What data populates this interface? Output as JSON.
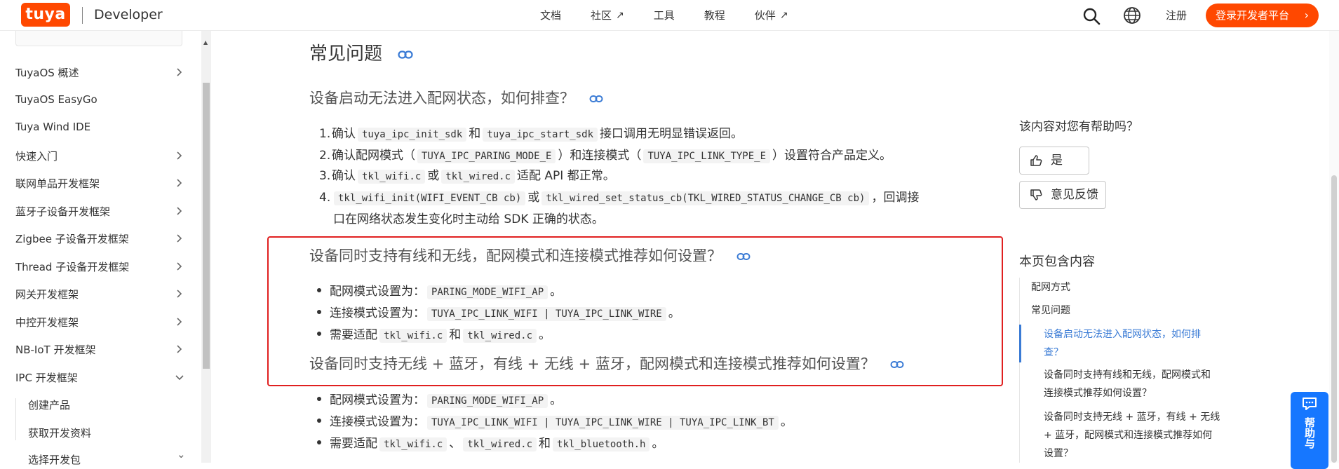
{
  "header": {
    "logo_text": "tuya",
    "developer_label": "Developer",
    "nav": [
      {
        "label": "文档",
        "external": false
      },
      {
        "label": "社区",
        "external": true
      },
      {
        "label": "工具",
        "external": false
      },
      {
        "label": "教程",
        "external": false
      },
      {
        "label": "伙伴",
        "external": true
      }
    ],
    "register_label": "注册",
    "login_label": "登录开发者平台"
  },
  "sidebar": {
    "items": [
      {
        "label": "TuyaOS 概述",
        "chevron": "right"
      },
      {
        "label": "TuyaOS EasyGo",
        "chevron": ""
      },
      {
        "label": "Tuya Wind IDE",
        "chevron": ""
      },
      {
        "label": "快速入门",
        "chevron": "right"
      },
      {
        "label": "联网单品开发框架",
        "chevron": "right"
      },
      {
        "label": "蓝牙子设备开发框架",
        "chevron": "right"
      },
      {
        "label": "Zigbee 子设备开发框架",
        "chevron": "right"
      },
      {
        "label": "Thread 子设备开发框架",
        "chevron": "right"
      },
      {
        "label": "网关开发框架",
        "chevron": "right"
      },
      {
        "label": "中控开发框架",
        "chevron": "right"
      },
      {
        "label": "NB-IoT 开发框架",
        "chevron": "right"
      },
      {
        "label": "IPC 开发框架",
        "chevron": "down"
      }
    ],
    "sub_items": [
      {
        "label": "创建产品"
      },
      {
        "label": "获取开发资料"
      },
      {
        "label": "选择开发包"
      }
    ]
  },
  "content": {
    "section_title": "常见问题",
    "q1": {
      "title": "设备启动无法进入配网状态，如何排查？",
      "steps": [
        {
          "num": "1.",
          "parts": [
            {
              "t": "确认"
            },
            {
              "c": "tuya_ipc_init_sdk"
            },
            {
              "t": "和"
            },
            {
              "c": "tuya_ipc_start_sdk"
            },
            {
              "t": "接口调用无明显错误返回。"
            }
          ]
        },
        {
          "num": "2.",
          "parts": [
            {
              "t": "确认配网模式（"
            },
            {
              "c": "TUYA_IPC_PARING_MODE_E"
            },
            {
              "t": "）和连接模式（"
            },
            {
              "c": "TUYA_IPC_LINK_TYPE_E"
            },
            {
              "t": "）设置符合产品定义。"
            }
          ]
        },
        {
          "num": "3.",
          "parts": [
            {
              "t": "确认"
            },
            {
              "c": "tkl_wifi.c"
            },
            {
              "t": "或"
            },
            {
              "c": "tkl_wired.c"
            },
            {
              "t": "适配 API 都正常。"
            }
          ]
        },
        {
          "num": "4.",
          "parts": [
            {
              "c": "tkl_wifi_init(WIFI_EVENT_CB cb)"
            },
            {
              "t": "或"
            },
            {
              "c": "tkl_wired_set_status_cb(TKL_WIRED_STATUS_CHANGE_CB cb)"
            },
            {
              "t": "，回调接"
            }
          ]
        }
      ],
      "step4_continued": "口在网络状态发生变化时主动给 SDK 正确的状态。"
    },
    "q2": {
      "title": "设备同时支持有线和无线，配网模式和连接模式推荐如何设置？",
      "bullets": [
        {
          "parts": [
            {
              "t": "配网模式设置为："
            },
            {
              "c": "PARING_MODE_WIFI_AP"
            },
            {
              "t": "。"
            }
          ]
        },
        {
          "parts": [
            {
              "t": "连接模式设置为："
            },
            {
              "c": "TUYA_IPC_LINK_WIFI | TUYA_IPC_LINK_WIRE"
            },
            {
              "t": "。"
            }
          ]
        },
        {
          "parts": [
            {
              "t": "需要适配"
            },
            {
              "c": "tkl_wifi.c"
            },
            {
              "t": "和"
            },
            {
              "c": "tkl_wired.c"
            },
            {
              "t": "。"
            }
          ]
        }
      ]
    },
    "q3": {
      "title": "设备同时支持无线 + 蓝牙，有线 + 无线 + 蓝牙，配网模式和连接模式推荐如何设置？",
      "bullets": [
        {
          "parts": [
            {
              "t": "配网模式设置为："
            },
            {
              "c": "PARING_MODE_WIFI_AP"
            },
            {
              "t": "。"
            }
          ]
        },
        {
          "parts": [
            {
              "t": "连接模式设置为："
            },
            {
              "c": "TUYA_IPC_LINK_WIFI | TUYA_IPC_LINK_WIRE | TUYA_IPC_LINK_BT"
            },
            {
              "t": "。"
            }
          ]
        },
        {
          "parts": [
            {
              "t": "需要适配"
            },
            {
              "c": "tkl_wifi.c"
            },
            {
              "t": "、"
            },
            {
              "c": "tkl_wired.c"
            },
            {
              "t": "和"
            },
            {
              "c": "tkl_bluetooth.h"
            },
            {
              "t": "。"
            }
          ]
        }
      ]
    }
  },
  "feedback": {
    "question": "该内容对您有帮助吗？",
    "yes_label": "是",
    "feedback_label": "意见反馈"
  },
  "toc": {
    "title": "本页包含内容",
    "items": [
      {
        "label": "配网方式",
        "level": 1,
        "active": false
      },
      {
        "label": "常见问题",
        "level": 1,
        "active": false
      },
      {
        "line1": "设备启动无法进入配网状态，如何排",
        "line2": "查？",
        "level": 2,
        "active": true
      },
      {
        "line1": "设备同时支持有线和无线，配网模式和",
        "line2": "连接模式推荐如何设置？",
        "level": 2,
        "active": false
      },
      {
        "line1": "设备同时支持无线 + 蓝牙，有线 + 无线",
        "line2": "+ 蓝牙，配网模式和连接模式推荐如何",
        "line3": "设置？",
        "level": 2,
        "active": false
      }
    ]
  },
  "help_widget": {
    "label": "帮助与"
  },
  "colors": {
    "brand": "#ff4800",
    "link": "#3a7bd5",
    "highlight": "#e02020"
  }
}
